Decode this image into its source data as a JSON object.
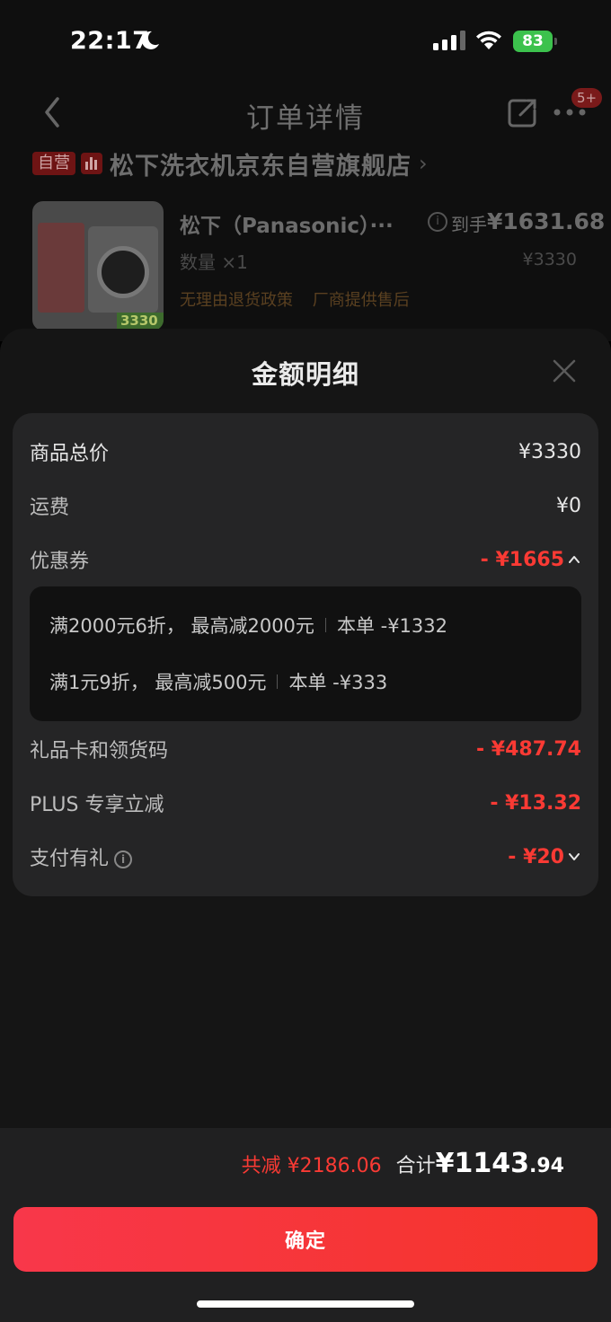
{
  "status_bar": {
    "time": "22:17",
    "battery": "83"
  },
  "nav": {
    "title": "订单详情",
    "badge": "5+"
  },
  "store": {
    "tag": "自营",
    "name": "松下洗衣机京东自营旗舰店"
  },
  "product": {
    "name": "松下（Panasonic）···",
    "price_label": "到手",
    "price_final": "¥1631.68",
    "quantity": "数量 ×1",
    "original_price": "¥3330",
    "thumb_price": "3330",
    "policies": [
      "无理由退货政策",
      "厂商提供售后"
    ]
  },
  "sheet": {
    "title": "金额明细",
    "rows": {
      "total": {
        "label": "商品总价",
        "value": "¥3330"
      },
      "shipping": {
        "label": "运费",
        "value": "¥0"
      },
      "coupon": {
        "label": "优惠券",
        "value": "- ¥1665"
      },
      "giftcard": {
        "label": "礼品卡和领货码",
        "value": "- ¥487.74"
      },
      "plus": {
        "label": "PLUS 专享立减",
        "value": "- ¥13.32"
      },
      "pay_gift": {
        "label": "支付有礼",
        "value": "- ¥20"
      }
    },
    "coupon_details": [
      {
        "rule": "满2000元6折，  最高减2000元",
        "amount": "本单 -¥1332"
      },
      {
        "rule": "满1元9折，  最高减500元",
        "amount": "本单 -¥333"
      }
    ]
  },
  "footer": {
    "saved": "共减 ¥2186.06",
    "total_label": "合计",
    "total_int": "¥1143",
    "total_dec": ".94",
    "confirm_label": "确定"
  },
  "colors": {
    "accent_red": "#fa3a34",
    "sheet_bg": "#151515",
    "card_bg": "#252526"
  }
}
